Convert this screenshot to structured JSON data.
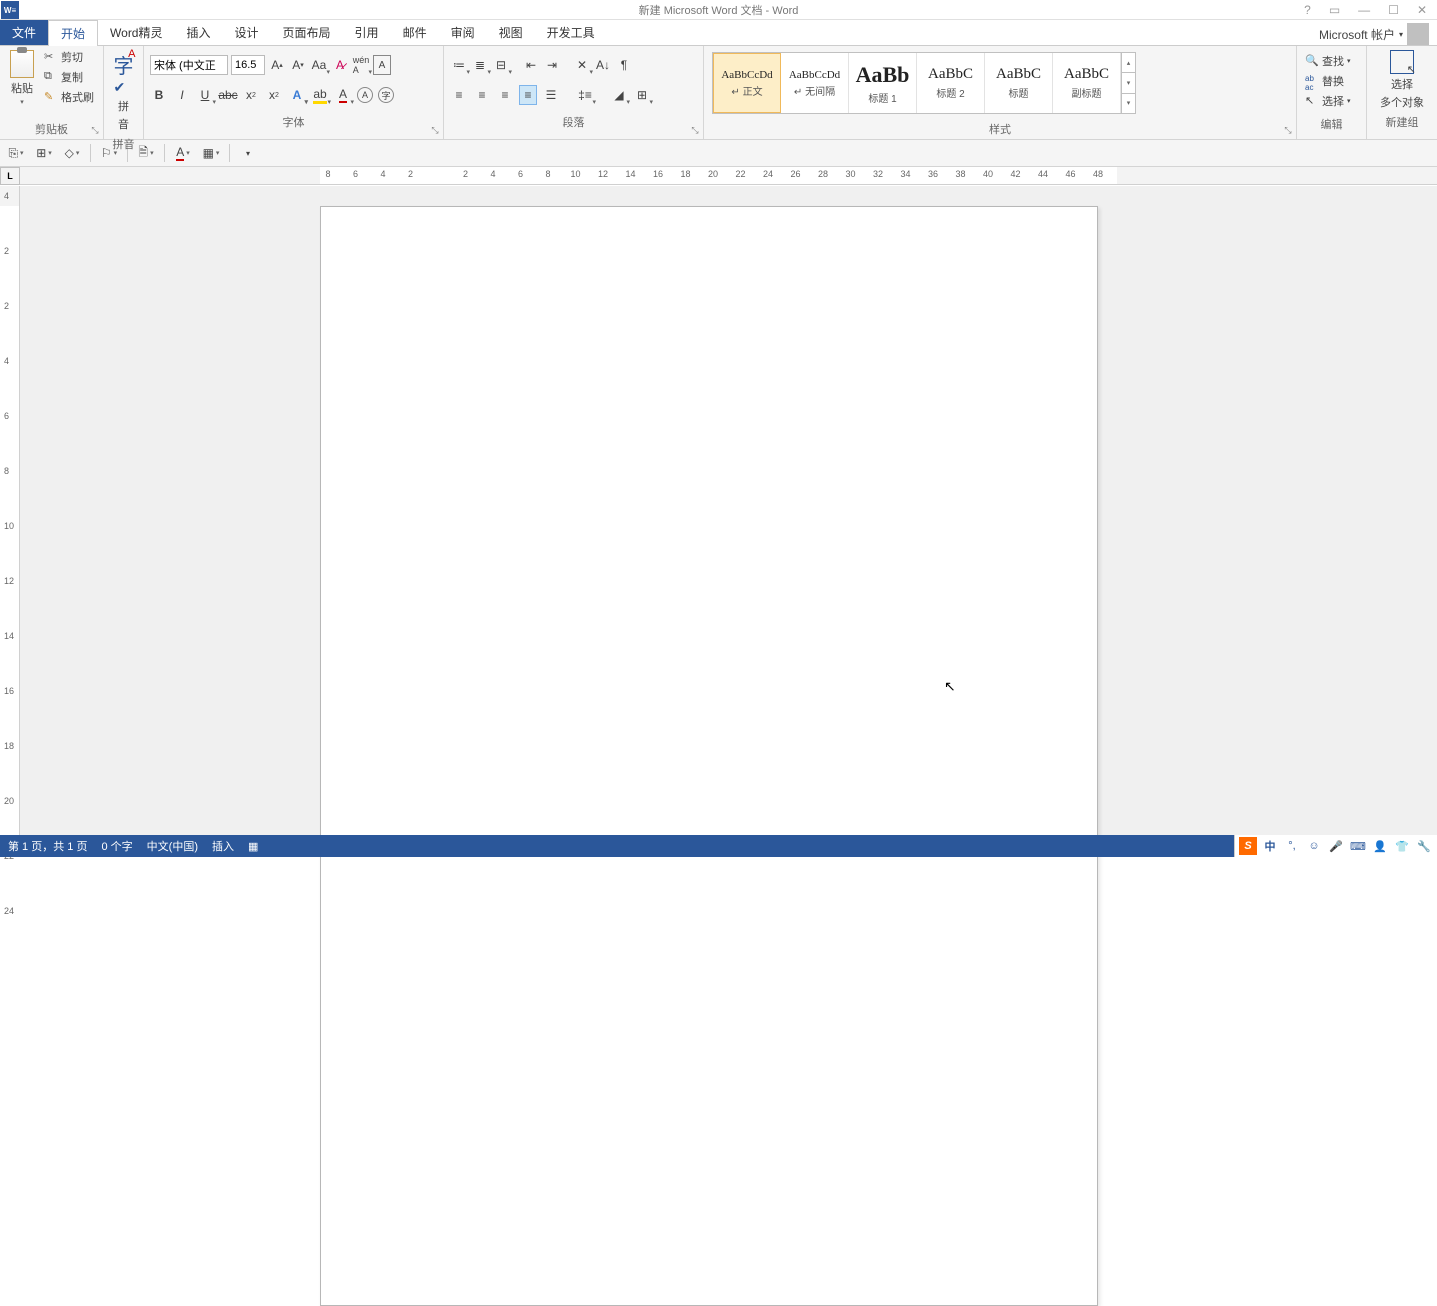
{
  "title": "新建 Microsoft Word 文档 - Word",
  "account_label": "Microsoft 帐户",
  "tabs": {
    "file": "文件",
    "home": "开始",
    "wordgenie": "Word精灵",
    "insert": "插入",
    "design": "设计",
    "layout": "页面布局",
    "references": "引用",
    "mailings": "邮件",
    "review": "审阅",
    "view": "视图",
    "devtools": "开发工具"
  },
  "clipboard": {
    "paste": "粘贴",
    "cut": "剪切",
    "copy": "复制",
    "formatpainter": "格式刷",
    "label": "剪贴板"
  },
  "pinyin": {
    "big_top": "字A",
    "line1": "拼",
    "line2": "音",
    "label": "拼音"
  },
  "font": {
    "name": "宋体 (中文正",
    "size": "16.5",
    "label": "字体"
  },
  "paragraph": {
    "label": "段落"
  },
  "styles": {
    "label": "样式",
    "items": [
      {
        "preview": "AaBbCcDd",
        "label": "↵ 正文",
        "size": "11px"
      },
      {
        "preview": "AaBbCcDd",
        "label": "↵ 无间隔",
        "size": "11px"
      },
      {
        "preview": "AaBb",
        "label": "标题 1",
        "size": "22px"
      },
      {
        "preview": "AaBbC",
        "label": "标题 2",
        "size": "15px"
      },
      {
        "preview": "AaBbC",
        "label": "标题",
        "size": "15px"
      },
      {
        "preview": "AaBbC",
        "label": "副标题",
        "size": "15px"
      }
    ]
  },
  "editing": {
    "find": "查找",
    "replace": "替换",
    "select": "选择",
    "label": "编辑"
  },
  "newgroup": {
    "line1": "选择",
    "line2": "多个对象",
    "label": "新建组"
  },
  "ruler_h": [
    "8",
    "6",
    "4",
    "2",
    "",
    "2",
    "4",
    "6",
    "8",
    "10",
    "12",
    "14",
    "16",
    "18",
    "20",
    "22",
    "24",
    "26",
    "28",
    "30",
    "32",
    "34",
    "36",
    "38",
    "40",
    "42",
    "44",
    "46",
    "48"
  ],
  "ruler_v": [
    "4",
    "",
    "2",
    "",
    "2",
    "",
    "4",
    "",
    "6",
    "",
    "8",
    "",
    "10",
    "",
    "12",
    "",
    "14",
    "",
    "16",
    "",
    "18",
    "",
    "20",
    "",
    "22",
    "",
    "24"
  ],
  "tabstop_char": "L",
  "status": {
    "page": "第 1 页，共 1 页",
    "words": "0 个字",
    "lang": "中文(中国)",
    "mode": "插入"
  },
  "ime": {
    "sogou": "S",
    "zh": "中"
  }
}
